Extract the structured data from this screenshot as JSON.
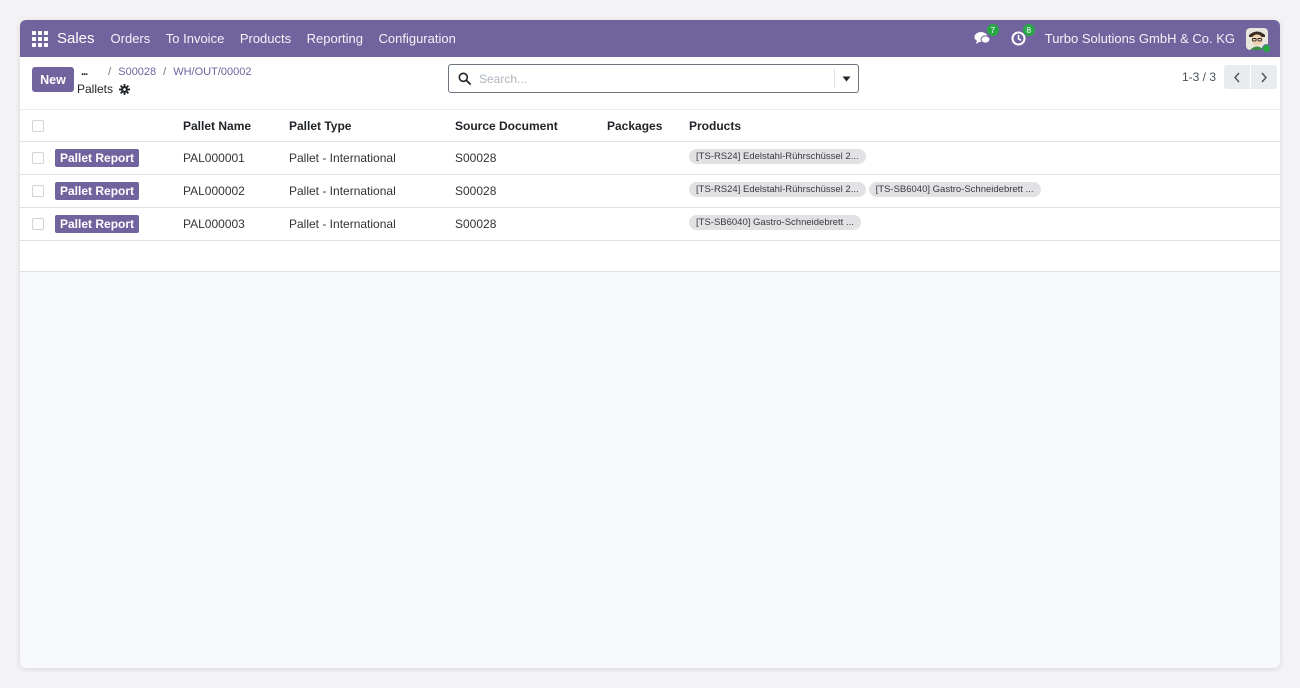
{
  "navbar": {
    "app_name": "Sales",
    "menu": [
      "Orders",
      "To Invoice",
      "Products",
      "Reporting",
      "Configuration"
    ],
    "messages_count": "7",
    "activities_count": "8",
    "company": "Turbo Solutions GmbH & Co. KG"
  },
  "control_panel": {
    "new_label": "New",
    "breadcrumb_more": "...",
    "breadcrumbs": [
      "S00028",
      "WH/OUT/00002"
    ],
    "title": "Pallets",
    "search_placeholder": "Search...",
    "pager": "1-3 / 3"
  },
  "table": {
    "columns": [
      "Pallet Name",
      "Pallet Type",
      "Source Document",
      "Packages",
      "Products"
    ],
    "rows": [
      {
        "action": "Pallet Report",
        "name": "PAL000001",
        "type": "Pallet - International",
        "source": "S00028",
        "packages": "",
        "products": [
          "[TS-RS24] Edelstahl-Rührschüssel 2..."
        ]
      },
      {
        "action": "Pallet Report",
        "name": "PAL000002",
        "type": "Pallet - International",
        "source": "S00028",
        "packages": "",
        "products": [
          "[TS-RS24] Edelstahl-Rührschüssel 2...",
          "[TS-SB6040] Gastro-Schneidebrett ..."
        ]
      },
      {
        "action": "Pallet Report",
        "name": "PAL000003",
        "type": "Pallet - International",
        "source": "S00028",
        "packages": "",
        "products": [
          "[TS-SB6040] Gastro-Schneidebrett ..."
        ]
      }
    ]
  },
  "colors": {
    "brand": "#71639e",
    "badge_green": "#28a745"
  },
  "icons": {
    "apps": "apps-grid-icon",
    "messages": "chat-icon",
    "activities": "clock-icon",
    "settings": "gear-icon",
    "search": "search-icon",
    "dropdown": "caret-down-icon",
    "prev": "chevron-left-icon",
    "next": "chevron-right-icon"
  }
}
